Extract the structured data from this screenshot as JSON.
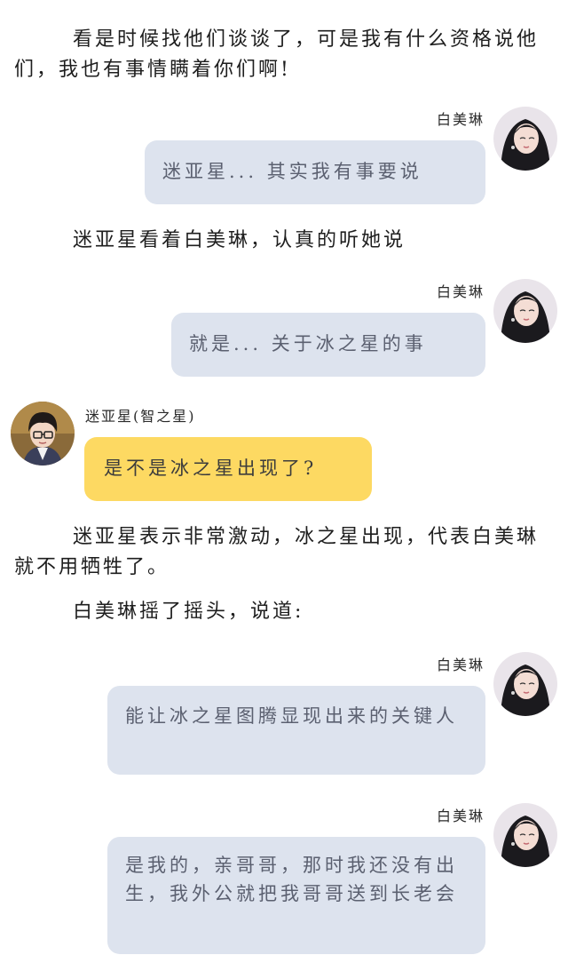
{
  "narration": [
    {
      "id": "n1",
      "text": "看是时候找他们谈谈了，可是我有什么资格说他们，我也有事情瞒着你们啊!"
    },
    {
      "id": "n2",
      "text": "迷亚星看着白美琳，认真的听她说"
    },
    {
      "id": "n3",
      "text": "迷亚星表示非常激动，冰之星出现，代表白美琳就不用牺牲了。"
    },
    {
      "id": "n4",
      "text": "白美琳摇了摇头，说道:"
    }
  ],
  "messages": [
    {
      "speaker": "白美琳",
      "side": "right",
      "text": "迷亚星... 其实我有事要说"
    },
    {
      "speaker": "白美琳",
      "side": "right",
      "text": "就是... 关于冰之星的事"
    },
    {
      "speaker": "迷亚星(智之星)",
      "side": "left",
      "text": "是不是冰之星出现了?"
    },
    {
      "speaker": "白美琳",
      "side": "right",
      "text": "能让冰之星图腾显现出来的关键人"
    },
    {
      "speaker": "白美琳",
      "side": "right",
      "text": "是我的，亲哥哥，那时我还没有出生，我外公就把我哥哥送到长老会"
    }
  ],
  "colors": {
    "bubble_right": "#dde3ee",
    "bubble_left": "#fdd962",
    "text": "#1e1e1e"
  },
  "icons": {
    "avatar_right": "girl-avatar-icon",
    "avatar_left": "boy-avatar-icon"
  }
}
